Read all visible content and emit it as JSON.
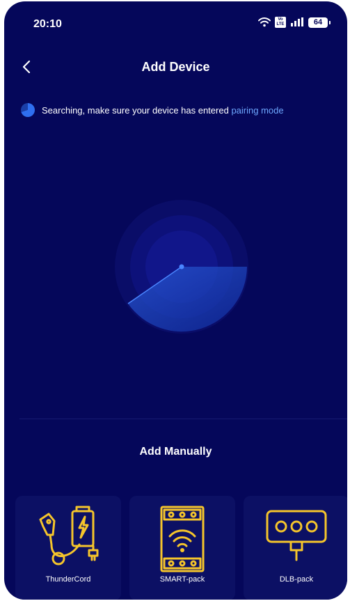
{
  "status": {
    "time": "20:10",
    "volte_top": "Vo",
    "volte_bottom": "LTE",
    "battery": "64"
  },
  "header": {
    "title": "Add Device"
  },
  "search": {
    "message": "Searching, make sure your device has entered ",
    "link": "pairing mode"
  },
  "manual": {
    "title": "Add Manually"
  },
  "devices": [
    {
      "name": "ThunderCord",
      "icon": "ev-charger-icon"
    },
    {
      "name": "SMART-pack",
      "icon": "wifi-module-icon"
    },
    {
      "name": "DLB-pack",
      "icon": "dlb-socket-icon"
    }
  ],
  "colors": {
    "background": "#05075a",
    "accent": "#2f6ff0",
    "link": "#6ea8ff",
    "icon": "#f5c52b",
    "card": "#0c1064"
  }
}
